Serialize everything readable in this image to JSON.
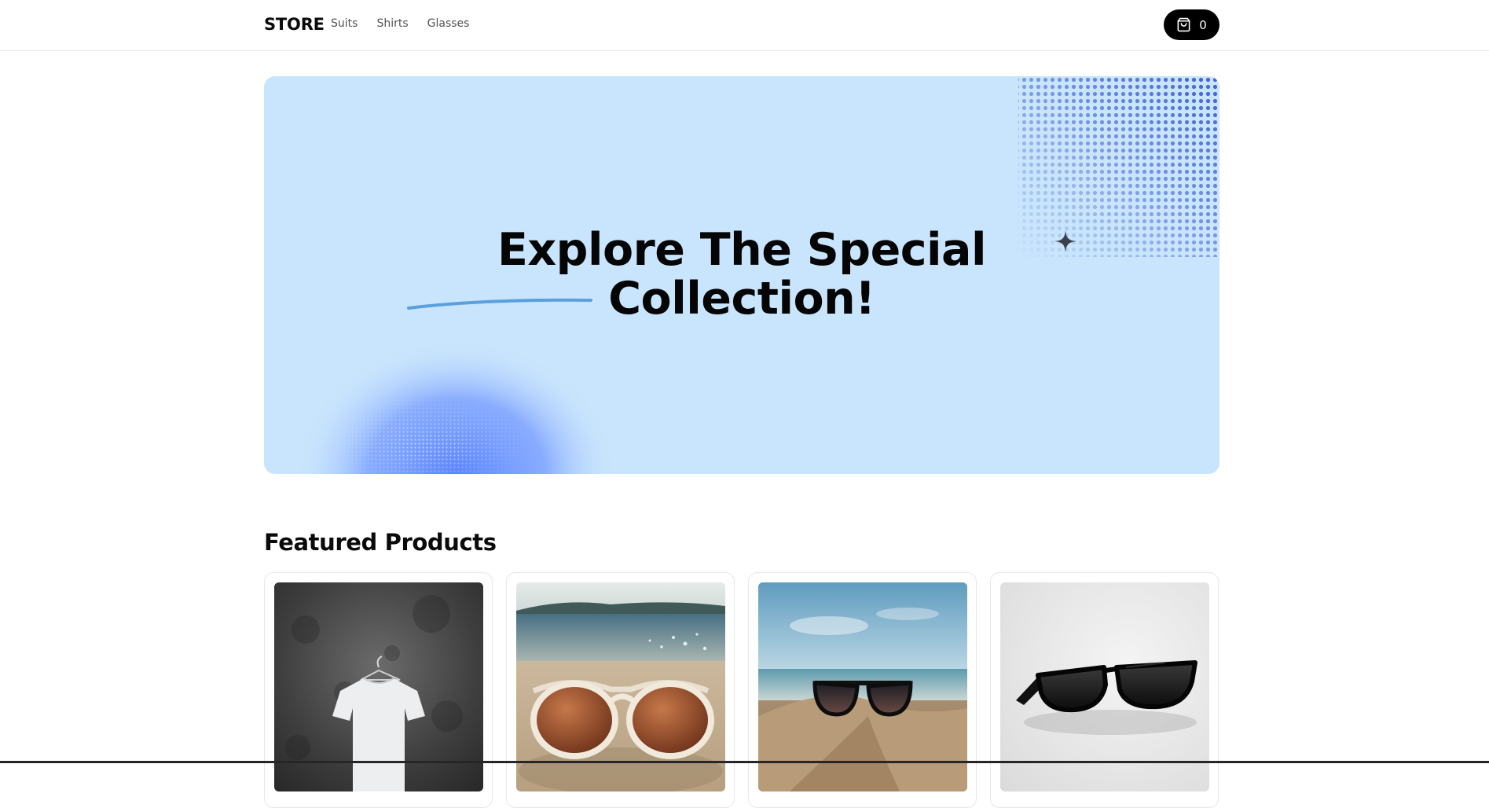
{
  "header": {
    "brand": "STORE",
    "nav": [
      {
        "label": "Suits"
      },
      {
        "label": "Shirts"
      },
      {
        "label": "Glasses"
      }
    ],
    "cart": {
      "count": "0",
      "icon": "shopping-bag-icon"
    }
  },
  "hero": {
    "title_line1": "Explore The Special",
    "title_line2": "Collection!",
    "colors": {
      "background": "#c9e5fd",
      "accent": "#3f5fd6"
    }
  },
  "featured": {
    "title": "Featured Products",
    "products": [
      {
        "image": "white-tshirt-on-hanger"
      },
      {
        "image": "sunglasses-on-beach-sand"
      },
      {
        "image": "sunglasses-in-sand-dunes"
      },
      {
        "image": "black-wayfarer-sunglasses"
      }
    ]
  }
}
